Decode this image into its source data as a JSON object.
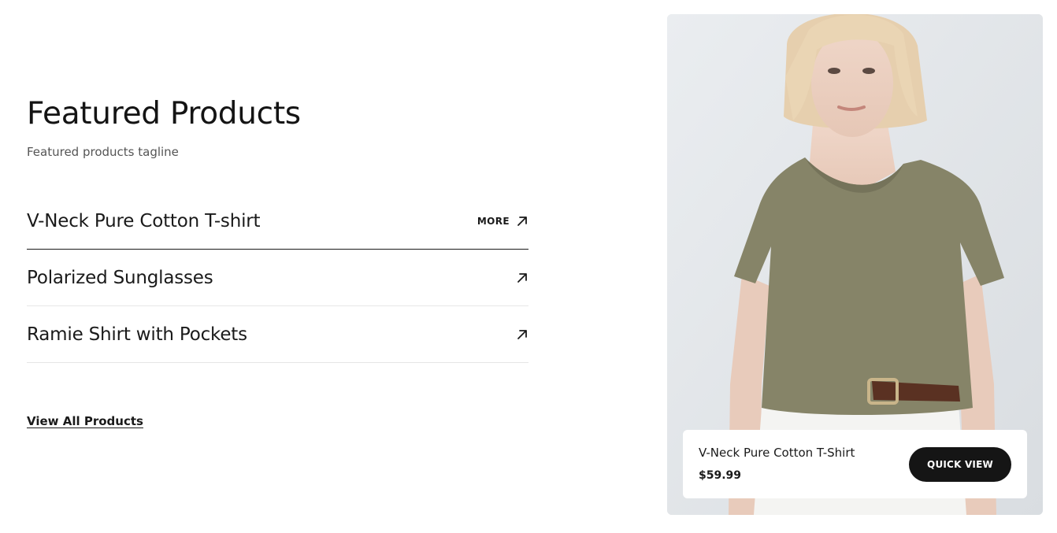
{
  "section": {
    "title": "Featured Products",
    "tagline": "Featured products tagline"
  },
  "products": [
    {
      "name": "V-Neck Pure Cotton T-shirt",
      "more_label": "MORE",
      "active": true
    },
    {
      "name": "Polarized Sunglasses",
      "more_label": "",
      "active": false
    },
    {
      "name": "Ramie Shirt with Pockets",
      "more_label": "",
      "active": false
    }
  ],
  "view_all_label": "View All Products",
  "feature_card": {
    "name": "V-Neck Pure Cotton T-Shirt",
    "price": "$59.99",
    "button_label": "QUICK VIEW"
  },
  "icons": {
    "item_arrow": "arrow-up-right-icon"
  },
  "colors": {
    "text": "#1a1a1a",
    "muted": "#555555",
    "divider": "#e6e6e6",
    "button_bg": "#151515",
    "shirt": "#868468"
  }
}
